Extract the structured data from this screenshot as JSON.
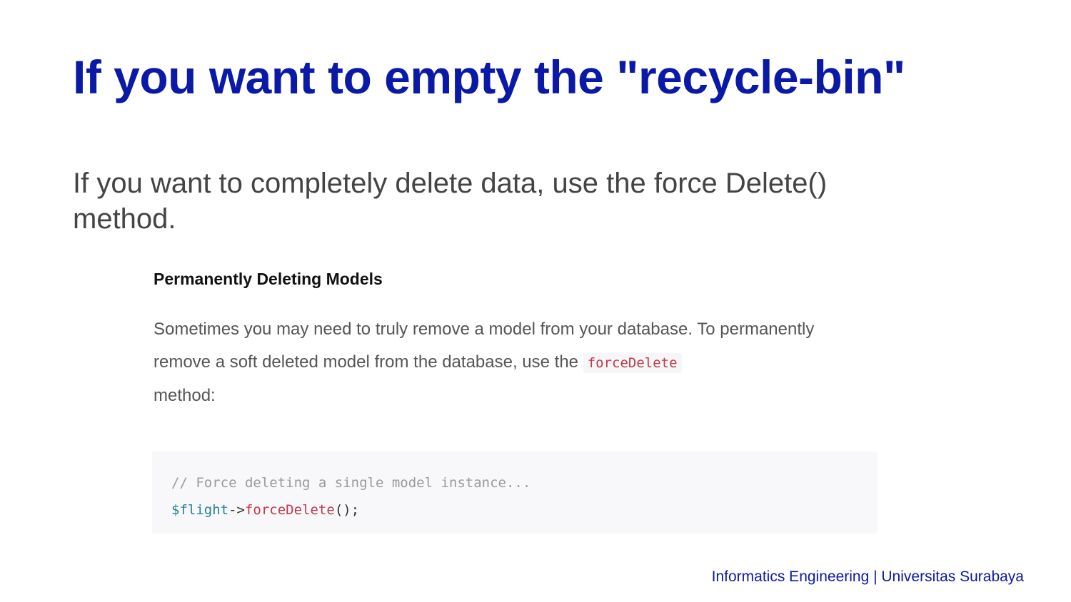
{
  "title": "If you want to empty the \"recycle-bin\"",
  "body": "If you want to completely delete data, use the force Delete() method.",
  "doc": {
    "heading": "Permanently Deleting Models",
    "para_before": "Sometimes you may need to truly remove a model from your database. To permanently remove a soft deleted model from the database, use the ",
    "inline_code": "forceDelete",
    "para_after": " method:",
    "code": {
      "comment": "// Force deleting a single model instance...",
      "var": "$flight",
      "arrow": "->",
      "method": "forceDelete",
      "tail": "();"
    }
  },
  "footer": "Informatics Engineering | Universitas Surabaya"
}
